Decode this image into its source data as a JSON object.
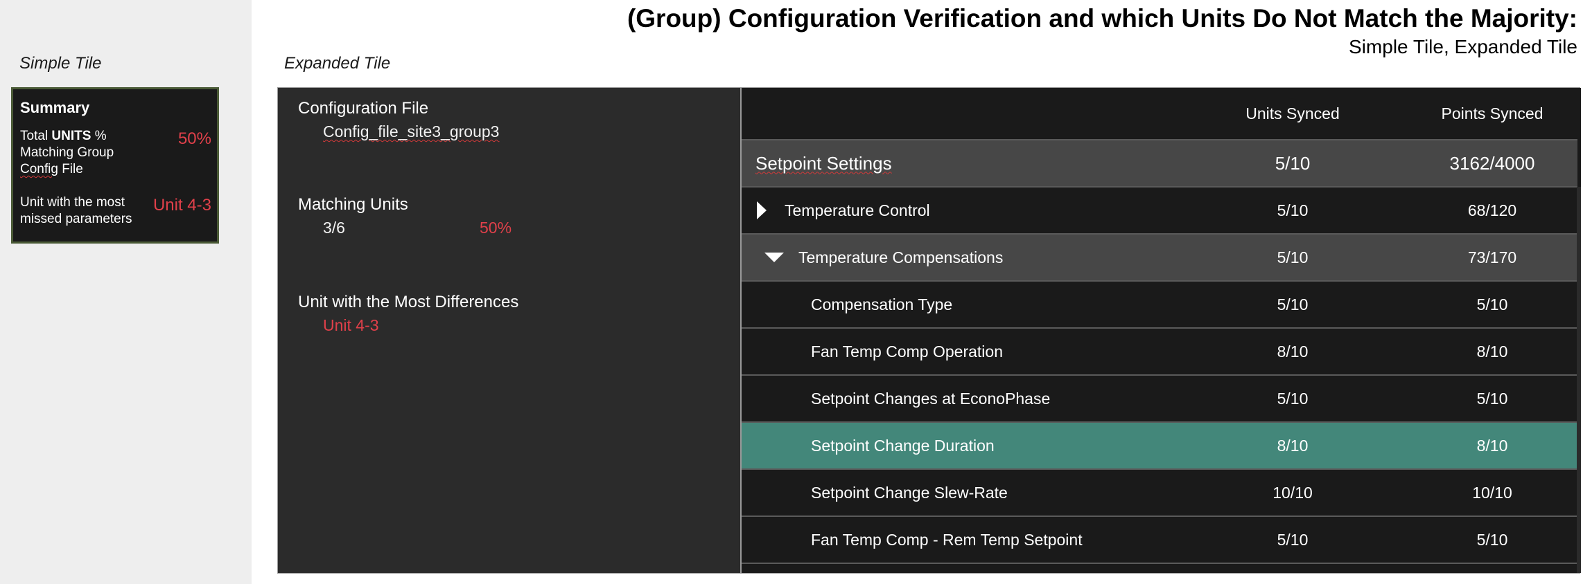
{
  "header": {
    "title": "(Group) Configuration Verification and which Units Do Not Match the Majority:",
    "subtitle": "Simple Tile, Expanded Tile"
  },
  "captions": {
    "simple": "Simple Tile",
    "expanded": "Expanded Tile"
  },
  "simple_tile": {
    "title": "Summary",
    "metric1_label_pre": "Total ",
    "metric1_label_bold": "UNITS",
    "metric1_label_post": " % Matching Group ",
    "metric1_label_config": "Config",
    "metric1_label_end": " File",
    "metric1_value": "50%",
    "metric2_label": "Unit with the most missed parameters",
    "metric2_value": "Unit 4-3"
  },
  "expanded_tile": {
    "config_label": "Configuration File",
    "config_value": "Config_file_site3_group3",
    "matching_label": "Matching Units",
    "matching_value": "3/6",
    "matching_pct": "50%",
    "diff_label": "Unit with the Most Differences",
    "diff_value": "Unit 4-3"
  },
  "table": {
    "col_units": "Units Synced",
    "col_points": "Points Synced",
    "group": {
      "name": "Setpoint Settings",
      "units": "5/10",
      "points": "3162/4000"
    },
    "rows": [
      {
        "name": "Temperature Control",
        "units": "5/10",
        "points": "68/120"
      },
      {
        "name": "Temperature Compensations",
        "units": "5/10",
        "points": "73/170"
      },
      {
        "name": "Compensation Type",
        "units": "5/10",
        "points": "5/10"
      },
      {
        "name": "Fan Temp Comp Operation",
        "units": "8/10",
        "points": "8/10"
      },
      {
        "name": "Setpoint Changes at EconoPhase",
        "units": "5/10",
        "points": "5/10"
      },
      {
        "name": "Setpoint Change Duration",
        "units": "8/10",
        "points": "8/10"
      },
      {
        "name": "Setpoint Change Slew-Rate",
        "units": "10/10",
        "points": "10/10"
      },
      {
        "name": "Fan Temp Comp - Rem Temp Setpoint",
        "units": "5/10",
        "points": "5/10"
      }
    ]
  },
  "colors": {
    "accent_red": "#e0404a",
    "selected_row": "#43877a",
    "tile_border": "#4a5a36"
  }
}
